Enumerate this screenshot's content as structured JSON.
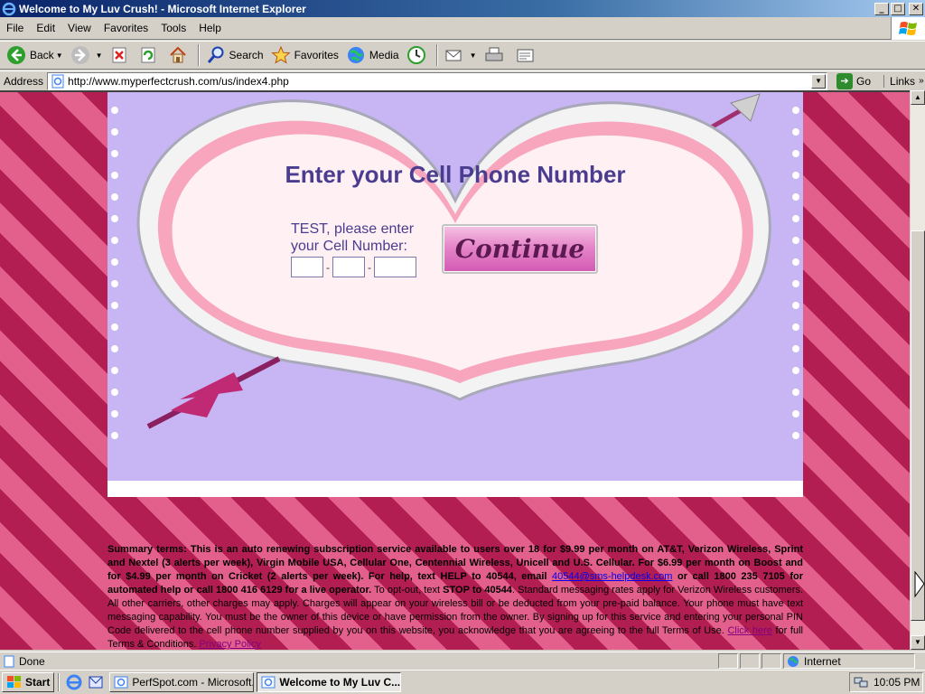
{
  "window": {
    "title": "Welcome to My Luv Crush! - Microsoft Internet Explorer",
    "buttons": {
      "minimize": "_",
      "maximize": "□",
      "close": "✕"
    }
  },
  "menubar": {
    "items": [
      "File",
      "Edit",
      "View",
      "Favorites",
      "Tools",
      "Help"
    ]
  },
  "toolbar": {
    "back_label": "Back",
    "search_label": "Search",
    "favorites_label": "Favorites",
    "media_label": "Media"
  },
  "addressbar": {
    "label": "Address",
    "url": "http://www.myperfectcrush.com/us/index4.php",
    "go_label": "Go",
    "links_label": "Links"
  },
  "page": {
    "headline": "Enter your Cell Phone Number",
    "prompt": "TEST, please enter your Cell Number:",
    "phone_separator": "-",
    "continue_label": "Continue",
    "terms": {
      "bold_text": "Summary terms: This is an auto renewing subscription service available to users over 18 for $9.99 per month on AT&T, Verizon Wireless, Sprint and Nextel (3 alerts per week), Virgin Mobile USA, Cellular One, Centennial Wireless, Unicell and U.S. Cellular. For $6.99 per month on Boost and for $4.99 per month on Cricket (2 alerts per week). For help, text HELP to 40544, email",
      "email_link": "40544@sms-helpdesk.com",
      "bold_text_2": "or call 1800 235 7105 for automated help or call 1800 416 6129 for a live operator.",
      "text_1": "To opt-out, text",
      "stop_text": "STOP to 40544",
      "text_2": ". Standard messaging rates apply for Verizon Wireless customers. All other carriers, other charges may apply. Charges will appear on your wireless bill or be deducted from your pre-paid balance. Your phone must have text messaging capability. You must be the owner of this device or have permission from the owner. By signing up for this service and entering your personal PIN Code delivered to the cell phone number supplied by you on this website, you acknowledge that you are agreeing to the full Terms of Use.",
      "click_here_link": "Click here",
      "text_3": "for full Terms & Conditions.",
      "privacy_link": "Privacy Policy"
    }
  },
  "statusbar": {
    "status": "Done",
    "zone": "Internet"
  },
  "taskbar": {
    "start_label": "Start",
    "tasks": [
      {
        "label": "PerfSpot.com - Microsoft..."
      },
      {
        "label": "Welcome to My Luv C..."
      }
    ],
    "clock": "10:05 PM"
  },
  "colors": {
    "stripe_dark": "#b31e52",
    "stripe_light": "#e4608c",
    "lavender": "#c8b6f4",
    "headline": "#4a3d8f"
  }
}
